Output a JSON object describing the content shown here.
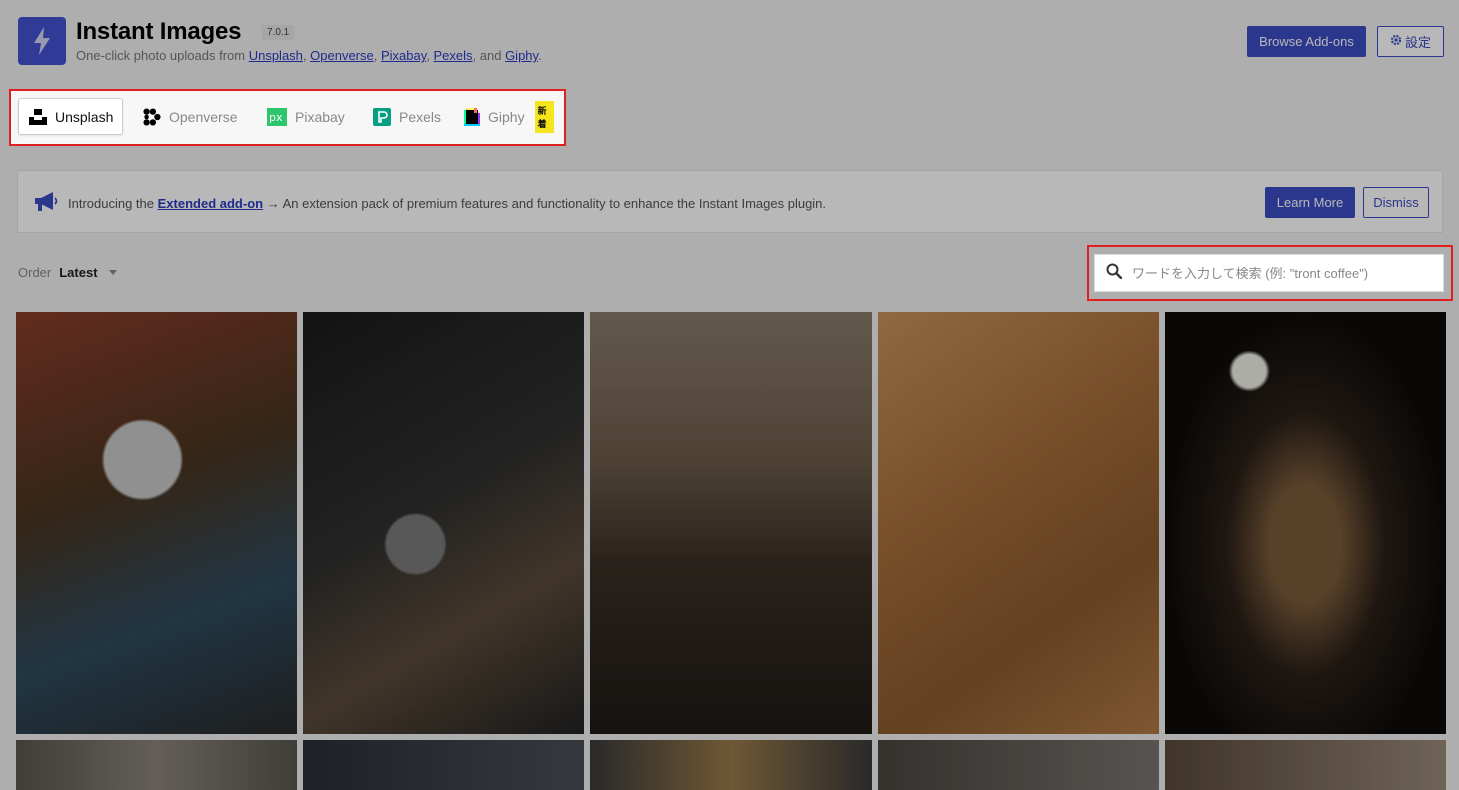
{
  "header": {
    "title": "Instant Images",
    "version": "7.0.1",
    "tagline_prefix": "One-click photo uploads from ",
    "tagline_links": [
      "Unsplash",
      "Openverse",
      "Pixabay",
      "Pexels",
      "Giphy"
    ],
    "tagline_sep": ", ",
    "tagline_and": ", and ",
    "tagline_end": ".",
    "browse_addons_label": "Browse Add-ons",
    "settings_label": "設定"
  },
  "providers": {
    "unsplash": "Unsplash",
    "openverse": "Openverse",
    "pixabay": "Pixabay",
    "pexels": "Pexels",
    "giphy": "Giphy",
    "new_badge": "新着"
  },
  "notice": {
    "prefix": "Introducing the ",
    "link": "Extended add-on",
    "suffix": " → An extension pack of premium features and functionality to enhance the Instant Images plugin.",
    "learn_more": "Learn More",
    "dismiss": "Dismiss"
  },
  "order": {
    "label": "Order",
    "value": "Latest"
  },
  "search": {
    "placeholder": "ワードを入力して検索 (例: \"tront coffee\")"
  },
  "colors": {
    "accent": "#3c4bc4",
    "highlight_border": "#e02020",
    "new_badge_bg": "#f5e51d"
  }
}
